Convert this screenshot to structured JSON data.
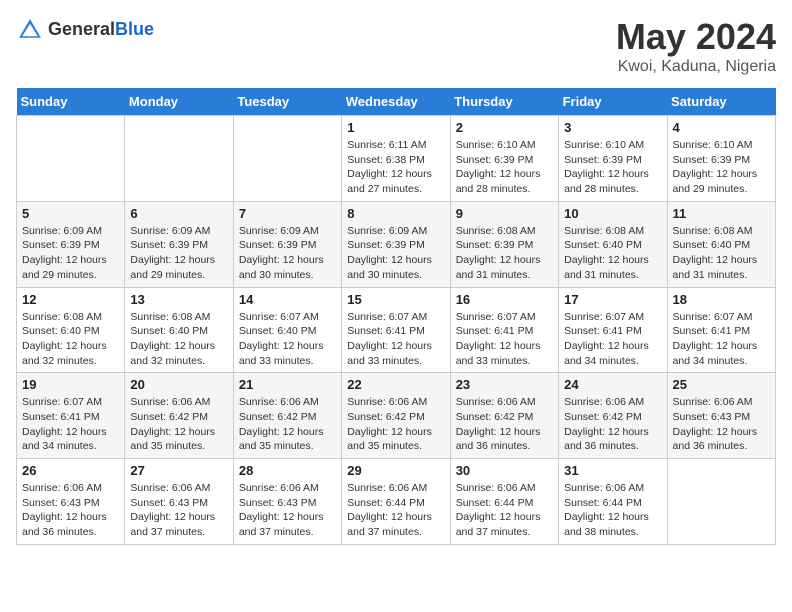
{
  "header": {
    "logo_general": "General",
    "logo_blue": "Blue",
    "month_year": "May 2024",
    "location": "Kwoi, Kaduna, Nigeria"
  },
  "days_of_week": [
    "Sunday",
    "Monday",
    "Tuesday",
    "Wednesday",
    "Thursday",
    "Friday",
    "Saturday"
  ],
  "weeks": [
    [
      {
        "day": "",
        "sunrise": "",
        "sunset": "",
        "daylight": ""
      },
      {
        "day": "",
        "sunrise": "",
        "sunset": "",
        "daylight": ""
      },
      {
        "day": "",
        "sunrise": "",
        "sunset": "",
        "daylight": ""
      },
      {
        "day": "1",
        "sunrise": "Sunrise: 6:11 AM",
        "sunset": "Sunset: 6:38 PM",
        "daylight": "Daylight: 12 hours and 27 minutes."
      },
      {
        "day": "2",
        "sunrise": "Sunrise: 6:10 AM",
        "sunset": "Sunset: 6:39 PM",
        "daylight": "Daylight: 12 hours and 28 minutes."
      },
      {
        "day": "3",
        "sunrise": "Sunrise: 6:10 AM",
        "sunset": "Sunset: 6:39 PM",
        "daylight": "Daylight: 12 hours and 28 minutes."
      },
      {
        "day": "4",
        "sunrise": "Sunrise: 6:10 AM",
        "sunset": "Sunset: 6:39 PM",
        "daylight": "Daylight: 12 hours and 29 minutes."
      }
    ],
    [
      {
        "day": "5",
        "sunrise": "Sunrise: 6:09 AM",
        "sunset": "Sunset: 6:39 PM",
        "daylight": "Daylight: 12 hours and 29 minutes."
      },
      {
        "day": "6",
        "sunrise": "Sunrise: 6:09 AM",
        "sunset": "Sunset: 6:39 PM",
        "daylight": "Daylight: 12 hours and 29 minutes."
      },
      {
        "day": "7",
        "sunrise": "Sunrise: 6:09 AM",
        "sunset": "Sunset: 6:39 PM",
        "daylight": "Daylight: 12 hours and 30 minutes."
      },
      {
        "day": "8",
        "sunrise": "Sunrise: 6:09 AM",
        "sunset": "Sunset: 6:39 PM",
        "daylight": "Daylight: 12 hours and 30 minutes."
      },
      {
        "day": "9",
        "sunrise": "Sunrise: 6:08 AM",
        "sunset": "Sunset: 6:39 PM",
        "daylight": "Daylight: 12 hours and 31 minutes."
      },
      {
        "day": "10",
        "sunrise": "Sunrise: 6:08 AM",
        "sunset": "Sunset: 6:40 PM",
        "daylight": "Daylight: 12 hours and 31 minutes."
      },
      {
        "day": "11",
        "sunrise": "Sunrise: 6:08 AM",
        "sunset": "Sunset: 6:40 PM",
        "daylight": "Daylight: 12 hours and 31 minutes."
      }
    ],
    [
      {
        "day": "12",
        "sunrise": "Sunrise: 6:08 AM",
        "sunset": "Sunset: 6:40 PM",
        "daylight": "Daylight: 12 hours and 32 minutes."
      },
      {
        "day": "13",
        "sunrise": "Sunrise: 6:08 AM",
        "sunset": "Sunset: 6:40 PM",
        "daylight": "Daylight: 12 hours and 32 minutes."
      },
      {
        "day": "14",
        "sunrise": "Sunrise: 6:07 AM",
        "sunset": "Sunset: 6:40 PM",
        "daylight": "Daylight: 12 hours and 33 minutes."
      },
      {
        "day": "15",
        "sunrise": "Sunrise: 6:07 AM",
        "sunset": "Sunset: 6:41 PM",
        "daylight": "Daylight: 12 hours and 33 minutes."
      },
      {
        "day": "16",
        "sunrise": "Sunrise: 6:07 AM",
        "sunset": "Sunset: 6:41 PM",
        "daylight": "Daylight: 12 hours and 33 minutes."
      },
      {
        "day": "17",
        "sunrise": "Sunrise: 6:07 AM",
        "sunset": "Sunset: 6:41 PM",
        "daylight": "Daylight: 12 hours and 34 minutes."
      },
      {
        "day": "18",
        "sunrise": "Sunrise: 6:07 AM",
        "sunset": "Sunset: 6:41 PM",
        "daylight": "Daylight: 12 hours and 34 minutes."
      }
    ],
    [
      {
        "day": "19",
        "sunrise": "Sunrise: 6:07 AM",
        "sunset": "Sunset: 6:41 PM",
        "daylight": "Daylight: 12 hours and 34 minutes."
      },
      {
        "day": "20",
        "sunrise": "Sunrise: 6:06 AM",
        "sunset": "Sunset: 6:42 PM",
        "daylight": "Daylight: 12 hours and 35 minutes."
      },
      {
        "day": "21",
        "sunrise": "Sunrise: 6:06 AM",
        "sunset": "Sunset: 6:42 PM",
        "daylight": "Daylight: 12 hours and 35 minutes."
      },
      {
        "day": "22",
        "sunrise": "Sunrise: 6:06 AM",
        "sunset": "Sunset: 6:42 PM",
        "daylight": "Daylight: 12 hours and 35 minutes."
      },
      {
        "day": "23",
        "sunrise": "Sunrise: 6:06 AM",
        "sunset": "Sunset: 6:42 PM",
        "daylight": "Daylight: 12 hours and 36 minutes."
      },
      {
        "day": "24",
        "sunrise": "Sunrise: 6:06 AM",
        "sunset": "Sunset: 6:42 PM",
        "daylight": "Daylight: 12 hours and 36 minutes."
      },
      {
        "day": "25",
        "sunrise": "Sunrise: 6:06 AM",
        "sunset": "Sunset: 6:43 PM",
        "daylight": "Daylight: 12 hours and 36 minutes."
      }
    ],
    [
      {
        "day": "26",
        "sunrise": "Sunrise: 6:06 AM",
        "sunset": "Sunset: 6:43 PM",
        "daylight": "Daylight: 12 hours and 36 minutes."
      },
      {
        "day": "27",
        "sunrise": "Sunrise: 6:06 AM",
        "sunset": "Sunset: 6:43 PM",
        "daylight": "Daylight: 12 hours and 37 minutes."
      },
      {
        "day": "28",
        "sunrise": "Sunrise: 6:06 AM",
        "sunset": "Sunset: 6:43 PM",
        "daylight": "Daylight: 12 hours and 37 minutes."
      },
      {
        "day": "29",
        "sunrise": "Sunrise: 6:06 AM",
        "sunset": "Sunset: 6:44 PM",
        "daylight": "Daylight: 12 hours and 37 minutes."
      },
      {
        "day": "30",
        "sunrise": "Sunrise: 6:06 AM",
        "sunset": "Sunset: 6:44 PM",
        "daylight": "Daylight: 12 hours and 37 minutes."
      },
      {
        "day": "31",
        "sunrise": "Sunrise: 6:06 AM",
        "sunset": "Sunset: 6:44 PM",
        "daylight": "Daylight: 12 hours and 38 minutes."
      },
      {
        "day": "",
        "sunrise": "",
        "sunset": "",
        "daylight": ""
      }
    ]
  ]
}
